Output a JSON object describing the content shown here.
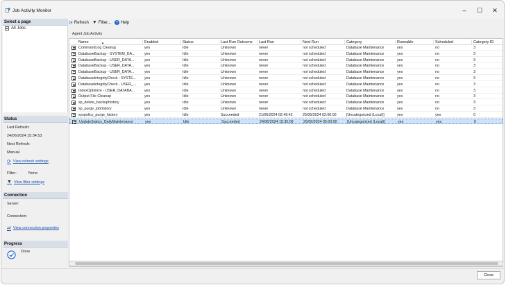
{
  "window": {
    "title": "Job Activity Monitor",
    "minimize": "–",
    "maximize": "☐",
    "close": "✕"
  },
  "left_pane": {
    "select_page": {
      "heading": "Select a page",
      "items": [
        "All Jobs"
      ]
    },
    "status": {
      "heading": "Status",
      "last_refresh_label": "Last Refresh:",
      "last_refresh_value": "24/06/2024 15:34:53",
      "next_refresh_label": "Next Refresh:",
      "next_refresh_value": "Manual",
      "view_refresh_settings": "View refresh settings",
      "filter_label": "Filter:",
      "filter_value": "None",
      "view_filter_settings": "View filter settings"
    },
    "connection": {
      "heading": "Connection",
      "server_label": "Server:",
      "connection_label": "Connection:",
      "view_connection_properties": "View connection properties"
    },
    "progress": {
      "heading": "Progress",
      "state": "Done"
    }
  },
  "toolbar": {
    "refresh": "Refresh",
    "filter": "Filter...",
    "help": "Help",
    "help_glyph": "?"
  },
  "grid": {
    "caption": "Agent Job Activity",
    "columns": [
      "Name",
      "Enabled",
      "Status",
      "Last Run Outcome",
      "Last Run",
      "Next Run",
      "Category",
      "Runnable",
      "Scheduled",
      "Category ID"
    ],
    "sort_indicator": "▲",
    "rows": [
      [
        "CommandLog Cleanup",
        "yes",
        "Idle",
        "Unknown",
        "never",
        "not scheduled",
        "Database Maintenance",
        "yes",
        "no",
        "3"
      ],
      [
        "DatabaseBackup - SYSTEM_DA...",
        "yes",
        "Idle",
        "Unknown",
        "never",
        "not scheduled",
        "Database Maintenance",
        "yes",
        "no",
        "3"
      ],
      [
        "DatabaseBackup - USER_DATA...",
        "yes",
        "Idle",
        "Unknown",
        "never",
        "not scheduled",
        "Database Maintenance",
        "yes",
        "no",
        "3"
      ],
      [
        "DatabaseBackup - USER_DATA...",
        "yes",
        "Idle",
        "Unknown",
        "never",
        "not scheduled",
        "Database Maintenance",
        "yes",
        "no",
        "3"
      ],
      [
        "DatabaseBackup - USER_DATA...",
        "yes",
        "Idle",
        "Unknown",
        "never",
        "not scheduled",
        "Database Maintenance",
        "yes",
        "no",
        "3"
      ],
      [
        "DatabaseIntegrityCheck - SYSTE...",
        "yes",
        "Idle",
        "Unknown",
        "never",
        "not scheduled",
        "Database Maintenance",
        "yes",
        "no",
        "3"
      ],
      [
        "DatabaseIntegrityCheck - USER_...",
        "yes",
        "Idle",
        "Unknown",
        "never",
        "not scheduled",
        "Database Maintenance",
        "yes",
        "no",
        "3"
      ],
      [
        "IndexOptimize - USER_DATABA...",
        "yes",
        "Idle",
        "Unknown",
        "never",
        "not scheduled",
        "Database Maintenance",
        "yes",
        "no",
        "3"
      ],
      [
        "Output File Cleanup",
        "yes",
        "Idle",
        "Unknown",
        "never",
        "not scheduled",
        "Database Maintenance",
        "yes",
        "no",
        "3"
      ],
      [
        "sp_delete_backuphistory",
        "yes",
        "Idle",
        "Unknown",
        "never",
        "not scheduled",
        "Database Maintenance",
        "yes",
        "no",
        "3"
      ],
      [
        "sp_purge_jobhistory",
        "yes",
        "Idle",
        "Unknown",
        "never",
        "not scheduled",
        "Database Maintenance",
        "yes",
        "no",
        "3"
      ],
      [
        "syspolicy_purge_history",
        "yes",
        "Idle",
        "Succeeded",
        "21/06/2024 02:49:42",
        "25/06/2024 02:00:00",
        "[Uncategorized (Local)]",
        "yes",
        "yes",
        "0"
      ],
      [
        "UpdateStatics_DailyMaintenance",
        "yes",
        "Idle",
        "Succeeded",
        "24/06/2024 15:35:09",
        "25/06/2024 05:00:00",
        "[Uncategorized (Local)]",
        "yes",
        "yes",
        "0"
      ]
    ],
    "selected_row": 12
  },
  "footer": {
    "close": "Close"
  },
  "colors": {
    "selection": "#cde3f7",
    "link": "#1a4fb0",
    "section_header": "#d9dfe8"
  }
}
